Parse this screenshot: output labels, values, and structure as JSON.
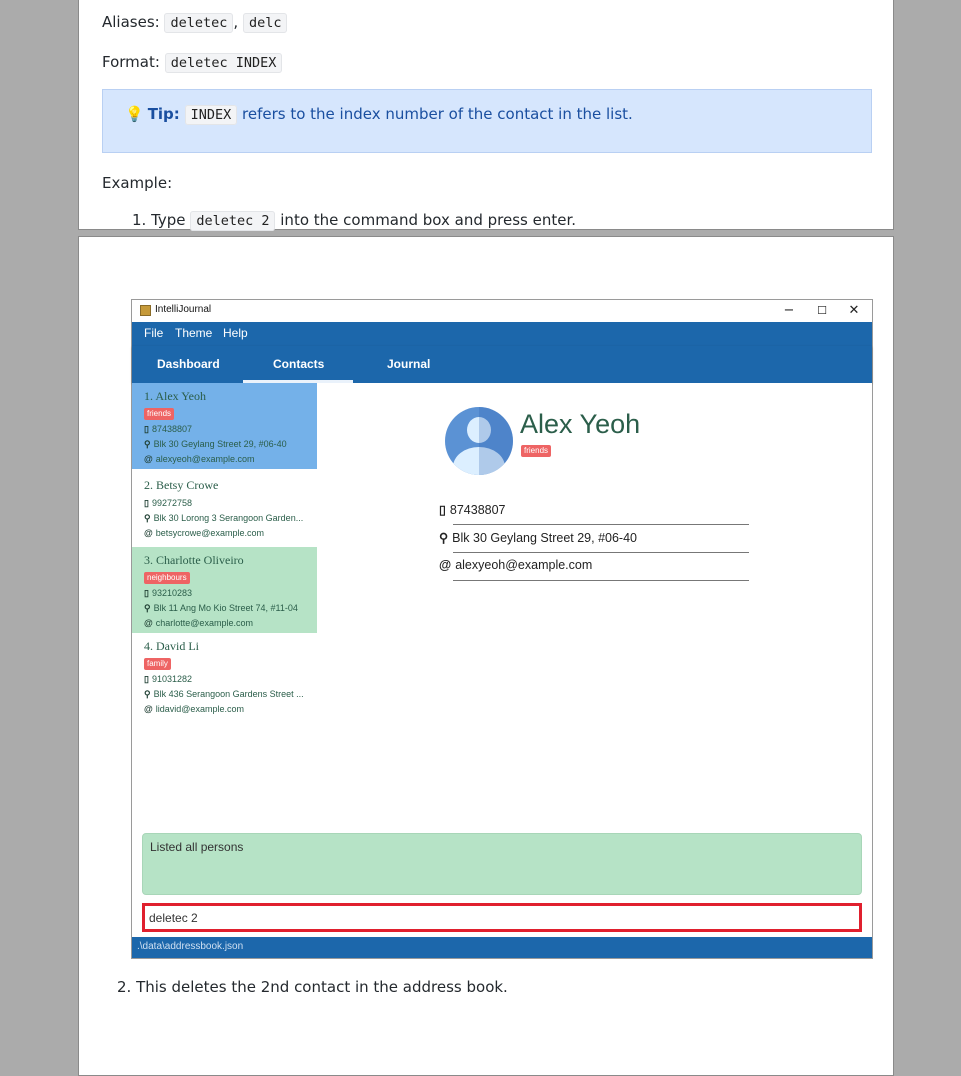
{
  "doc_top": {
    "aliases_label": "Aliases:",
    "alias_1": "deletec",
    "alias_sep": ",",
    "alias_2": "delc",
    "format_label": "Format:",
    "format_code": "deletec INDEX",
    "tip_bold": "Tip:",
    "tip_code": "INDEX",
    "tip_text": "refers to the index number of the contact in the list.",
    "example_label": "Example:",
    "step1_pre": "1. Type",
    "step1_code": "deletec 2",
    "step1_post": "into the command box and press enter."
  },
  "app": {
    "title": "IntelliJournal",
    "window_controls": [
      "−",
      "☐",
      "✕"
    ],
    "menus": [
      "File",
      "Theme",
      "Help"
    ],
    "tabs": [
      "Dashboard",
      "Contacts",
      "Journal"
    ],
    "active_tab": "Contacts",
    "contacts": [
      {
        "name": "1.  Alex Yeoh",
        "tag": "friends",
        "phone": "87438807",
        "address": "Blk 30 Geylang Street 29, #06-40",
        "email": "alexyeoh@example.com",
        "bg": "#74b1e9"
      },
      {
        "name": "2.  Betsy Crowe",
        "tag": "",
        "phone": "99272758",
        "address": "Blk 30 Lorong 3 Serangoon Garden...",
        "email": "betsycrowe@example.com",
        "bg": "#ffffff"
      },
      {
        "name": "3.  Charlotte Oliveiro",
        "tag": "neighbours",
        "phone": "93210283",
        "address": "Blk 11 Ang Mo Kio Street 74, #11-04",
        "email": "charlotte@example.com",
        "bg": "#b6e3c6"
      },
      {
        "name": "4.  David Li",
        "tag": "family",
        "phone": "91031282",
        "address": "Blk 436 Serangoon Gardens Street ...",
        "email": "lidavid@example.com",
        "bg": "#ffffff"
      }
    ],
    "detail": {
      "name": "Alex Yeoh",
      "tag": "friends",
      "phone": "87438807",
      "address": "Blk 30 Geylang Street 29, #06-40",
      "email": "alexyeoh@example.com"
    },
    "result_text": "Listed all persons",
    "command_value": "deletec 2",
    "status_path": ".\\data\\addressbook.json"
  },
  "doc_bottom": {
    "step2": "2. This deletes the 2nd contact in the address book."
  },
  "icons": {
    "phone": "phone-icon",
    "address": "location-pin-icon",
    "email": "at-icon",
    "tip": "lightbulb-icon"
  },
  "colors": {
    "app_blue": "#1c67ab",
    "selected_card": "#74b1e9",
    "green_card": "#b6e3c6",
    "tag_red": "#ee6464",
    "tip_bg": "#d6e6fd",
    "cmd_border": "#e0202e"
  }
}
